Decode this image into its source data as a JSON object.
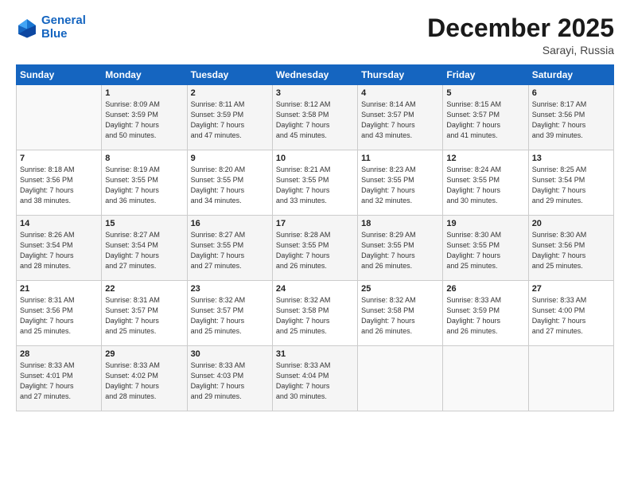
{
  "logo": {
    "line1": "General",
    "line2": "Blue"
  },
  "title": "December 2025",
  "subtitle": "Sarayi, Russia",
  "days_header": [
    "Sunday",
    "Monday",
    "Tuesday",
    "Wednesday",
    "Thursday",
    "Friday",
    "Saturday"
  ],
  "weeks": [
    [
      {
        "day": "",
        "info": ""
      },
      {
        "day": "1",
        "info": "Sunrise: 8:09 AM\nSunset: 3:59 PM\nDaylight: 7 hours\nand 50 minutes."
      },
      {
        "day": "2",
        "info": "Sunrise: 8:11 AM\nSunset: 3:59 PM\nDaylight: 7 hours\nand 47 minutes."
      },
      {
        "day": "3",
        "info": "Sunrise: 8:12 AM\nSunset: 3:58 PM\nDaylight: 7 hours\nand 45 minutes."
      },
      {
        "day": "4",
        "info": "Sunrise: 8:14 AM\nSunset: 3:57 PM\nDaylight: 7 hours\nand 43 minutes."
      },
      {
        "day": "5",
        "info": "Sunrise: 8:15 AM\nSunset: 3:57 PM\nDaylight: 7 hours\nand 41 minutes."
      },
      {
        "day": "6",
        "info": "Sunrise: 8:17 AM\nSunset: 3:56 PM\nDaylight: 7 hours\nand 39 minutes."
      }
    ],
    [
      {
        "day": "7",
        "info": "Sunrise: 8:18 AM\nSunset: 3:56 PM\nDaylight: 7 hours\nand 38 minutes."
      },
      {
        "day": "8",
        "info": "Sunrise: 8:19 AM\nSunset: 3:55 PM\nDaylight: 7 hours\nand 36 minutes."
      },
      {
        "day": "9",
        "info": "Sunrise: 8:20 AM\nSunset: 3:55 PM\nDaylight: 7 hours\nand 34 minutes."
      },
      {
        "day": "10",
        "info": "Sunrise: 8:21 AM\nSunset: 3:55 PM\nDaylight: 7 hours\nand 33 minutes."
      },
      {
        "day": "11",
        "info": "Sunrise: 8:23 AM\nSunset: 3:55 PM\nDaylight: 7 hours\nand 32 minutes."
      },
      {
        "day": "12",
        "info": "Sunrise: 8:24 AM\nSunset: 3:55 PM\nDaylight: 7 hours\nand 30 minutes."
      },
      {
        "day": "13",
        "info": "Sunrise: 8:25 AM\nSunset: 3:54 PM\nDaylight: 7 hours\nand 29 minutes."
      }
    ],
    [
      {
        "day": "14",
        "info": "Sunrise: 8:26 AM\nSunset: 3:54 PM\nDaylight: 7 hours\nand 28 minutes."
      },
      {
        "day": "15",
        "info": "Sunrise: 8:27 AM\nSunset: 3:54 PM\nDaylight: 7 hours\nand 27 minutes."
      },
      {
        "day": "16",
        "info": "Sunrise: 8:27 AM\nSunset: 3:55 PM\nDaylight: 7 hours\nand 27 minutes."
      },
      {
        "day": "17",
        "info": "Sunrise: 8:28 AM\nSunset: 3:55 PM\nDaylight: 7 hours\nand 26 minutes."
      },
      {
        "day": "18",
        "info": "Sunrise: 8:29 AM\nSunset: 3:55 PM\nDaylight: 7 hours\nand 26 minutes."
      },
      {
        "day": "19",
        "info": "Sunrise: 8:30 AM\nSunset: 3:55 PM\nDaylight: 7 hours\nand 25 minutes."
      },
      {
        "day": "20",
        "info": "Sunrise: 8:30 AM\nSunset: 3:56 PM\nDaylight: 7 hours\nand 25 minutes."
      }
    ],
    [
      {
        "day": "21",
        "info": "Sunrise: 8:31 AM\nSunset: 3:56 PM\nDaylight: 7 hours\nand 25 minutes."
      },
      {
        "day": "22",
        "info": "Sunrise: 8:31 AM\nSunset: 3:57 PM\nDaylight: 7 hours\nand 25 minutes."
      },
      {
        "day": "23",
        "info": "Sunrise: 8:32 AM\nSunset: 3:57 PM\nDaylight: 7 hours\nand 25 minutes."
      },
      {
        "day": "24",
        "info": "Sunrise: 8:32 AM\nSunset: 3:58 PM\nDaylight: 7 hours\nand 25 minutes."
      },
      {
        "day": "25",
        "info": "Sunrise: 8:32 AM\nSunset: 3:58 PM\nDaylight: 7 hours\nand 26 minutes."
      },
      {
        "day": "26",
        "info": "Sunrise: 8:33 AM\nSunset: 3:59 PM\nDaylight: 7 hours\nand 26 minutes."
      },
      {
        "day": "27",
        "info": "Sunrise: 8:33 AM\nSunset: 4:00 PM\nDaylight: 7 hours\nand 27 minutes."
      }
    ],
    [
      {
        "day": "28",
        "info": "Sunrise: 8:33 AM\nSunset: 4:01 PM\nDaylight: 7 hours\nand 27 minutes."
      },
      {
        "day": "29",
        "info": "Sunrise: 8:33 AM\nSunset: 4:02 PM\nDaylight: 7 hours\nand 28 minutes."
      },
      {
        "day": "30",
        "info": "Sunrise: 8:33 AM\nSunset: 4:03 PM\nDaylight: 7 hours\nand 29 minutes."
      },
      {
        "day": "31",
        "info": "Sunrise: 8:33 AM\nSunset: 4:04 PM\nDaylight: 7 hours\nand 30 minutes."
      },
      {
        "day": "",
        "info": ""
      },
      {
        "day": "",
        "info": ""
      },
      {
        "day": "",
        "info": ""
      }
    ]
  ]
}
